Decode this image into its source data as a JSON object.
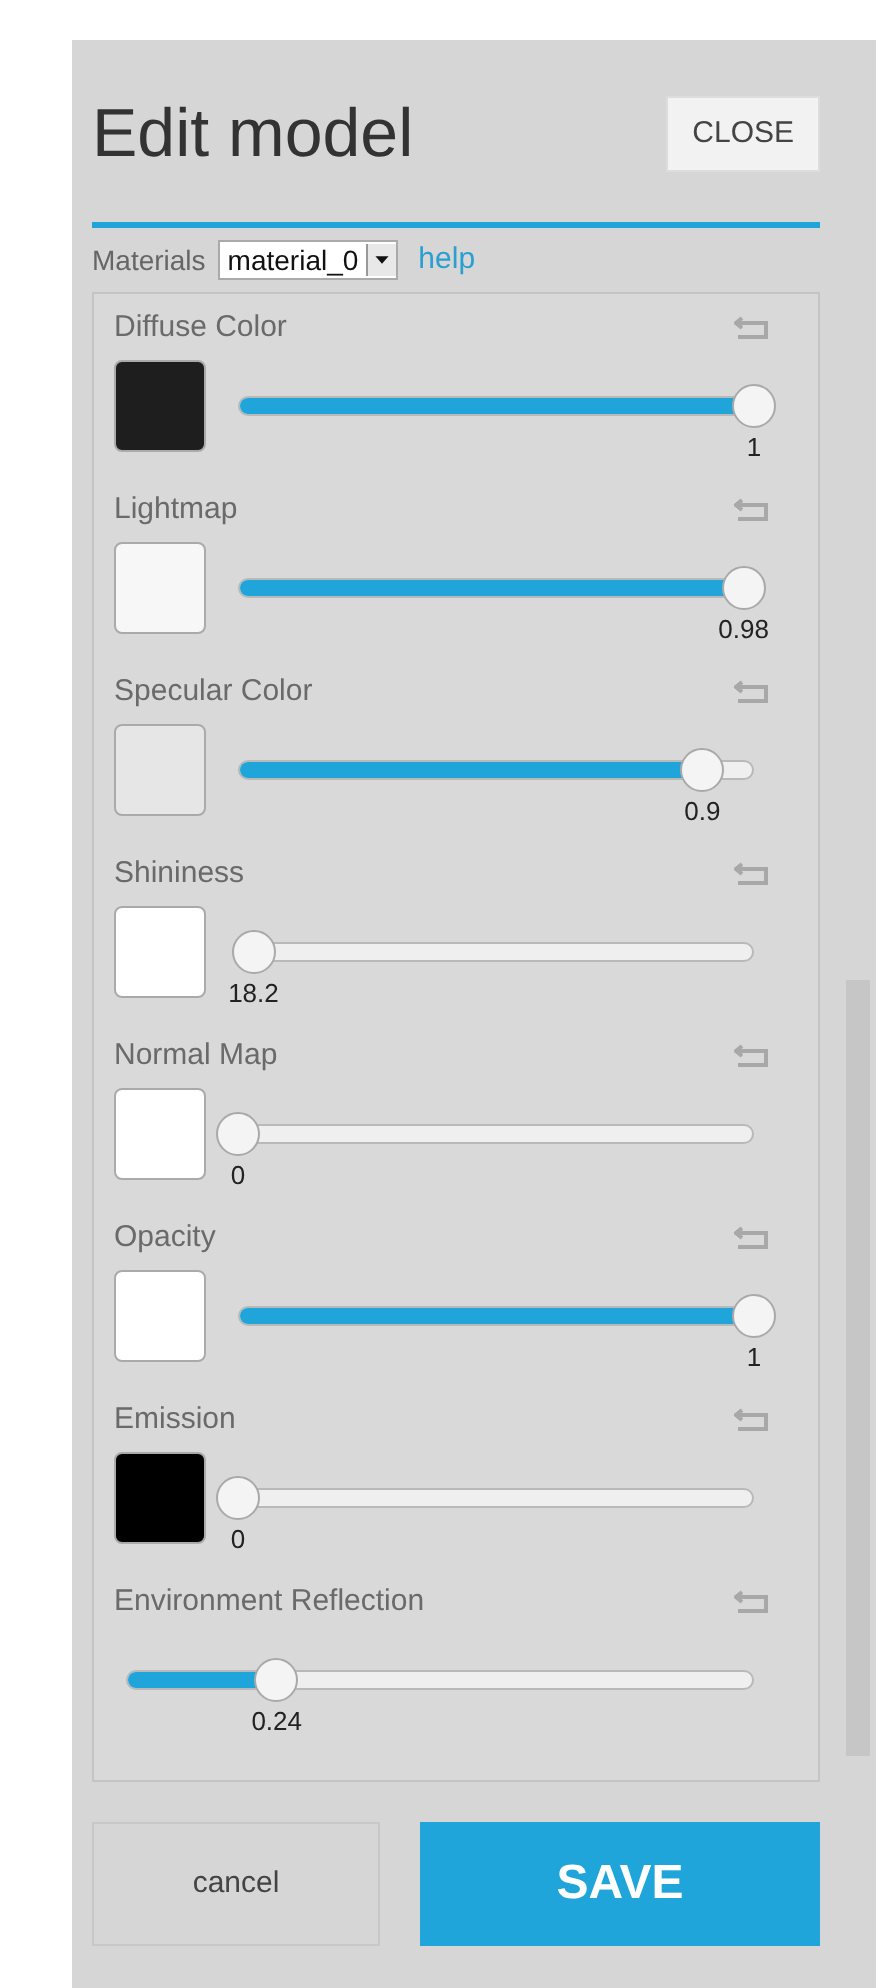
{
  "title": "Edit model",
  "close_button": "CLOSE",
  "materials": {
    "label": "Materials",
    "value": "material_0",
    "help": "help"
  },
  "properties": [
    {
      "kind": "color-slider",
      "label": "Diffuse Color",
      "color": "#1e1e1e",
      "level": 1,
      "reading": "1"
    },
    {
      "kind": "color-slider",
      "label": "Lightmap",
      "color": "#f7f7f7",
      "level": 0.98,
      "reading": "0.98"
    },
    {
      "kind": "color-slider",
      "label": "Specular Color",
      "color": "#e6e6e6",
      "level": 0.9,
      "reading": "0.9"
    },
    {
      "kind": "color-slider",
      "label": "Shininess",
      "color": "#ffffff",
      "level": 0.03,
      "reading": "18.2"
    },
    {
      "kind": "color-slider",
      "label": "Normal Map",
      "color": "#ffffff",
      "level": 0,
      "reading": "0"
    },
    {
      "kind": "color-slider",
      "label": "Opacity",
      "color": "#ffffff",
      "level": 1,
      "reading": "1"
    },
    {
      "kind": "color-slider",
      "label": "Emission",
      "color": "#000000",
      "level": 0,
      "reading": "0"
    },
    {
      "kind": "slider",
      "label": "Environment Reflection",
      "level": 0.24,
      "reading": "0.24"
    }
  ],
  "buttons": {
    "cancel": "cancel",
    "save": "SAVE"
  }
}
